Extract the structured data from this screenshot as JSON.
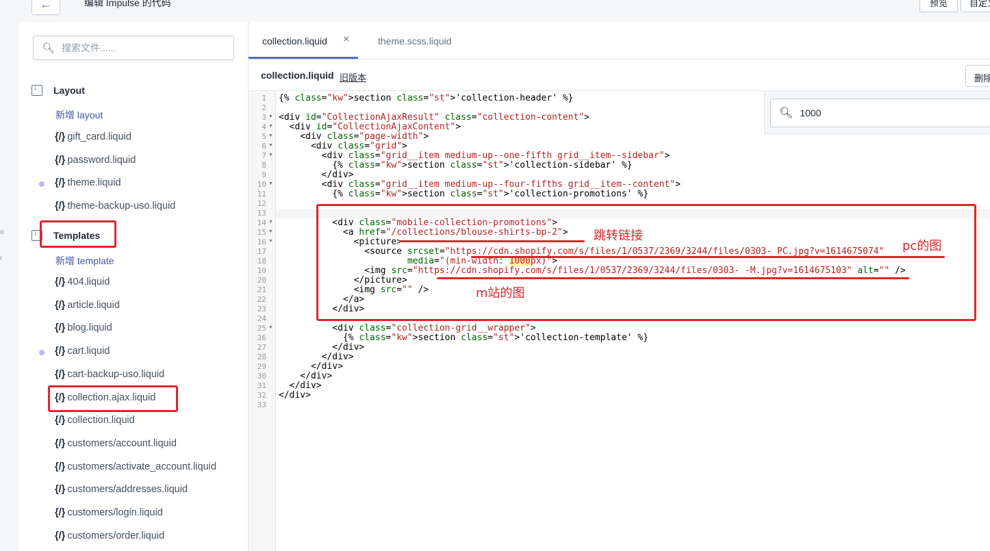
{
  "header": {
    "title": "编辑 Impulse 的代码",
    "back_icon": "arrow-left-icon",
    "preview_label": "预览",
    "customize_label": "自定义"
  },
  "left_gutter_marks": [
    "o",
    "r"
  ],
  "sidebar": {
    "search_placeholder": "搜索文件......",
    "layout": {
      "title": "Layout",
      "add_label": "新增 layout",
      "files": [
        {
          "name": "gift_card.liquid",
          "modified": false
        },
        {
          "name": "password.liquid",
          "modified": false
        },
        {
          "name": "theme.liquid",
          "modified": true
        },
        {
          "name": "theme-backup-uso.liquid",
          "modified": false
        }
      ]
    },
    "templates": {
      "title": "Templates",
      "add_label": "新增 template",
      "files": [
        {
          "name": "404.liquid",
          "modified": false
        },
        {
          "name": "article.liquid",
          "modified": false
        },
        {
          "name": "blog.liquid",
          "modified": false
        },
        {
          "name": "cart.liquid",
          "modified": true
        },
        {
          "name": "cart-backup-uso.liquid",
          "modified": false
        },
        {
          "name": "collection.ajax.liquid",
          "modified": false
        },
        {
          "name": "collection.liquid",
          "modified": false
        },
        {
          "name": "customers/account.liquid",
          "modified": false
        },
        {
          "name": "customers/activate_account.liquid",
          "modified": false
        },
        {
          "name": "customers/addresses.liquid",
          "modified": false
        },
        {
          "name": "customers/login.liquid",
          "modified": false
        },
        {
          "name": "customers/order.liquid",
          "modified": false
        }
      ]
    },
    "file_icon": "{/}"
  },
  "editor": {
    "tabs": [
      {
        "label": "collection.liquid",
        "active": true
      },
      {
        "label": "theme.scss.liquid",
        "active": false
      }
    ],
    "close_icon": "×",
    "file_name": "collection.liquid",
    "old_versions_label": "旧版本",
    "delete_label": "删除",
    "find_value": "1000",
    "line_count": 33,
    "fold_lines": [
      3,
      4,
      5,
      6,
      7,
      10,
      14,
      15,
      16,
      25
    ],
    "code_lines": [
      "{% section 'collection-header' %}",
      "",
      "<div id=\"CollectionAjaxResult\" class=\"collection-content\">",
      "  <div id=\"CollectionAjaxContent\">",
      "    <div class=\"page-width\">",
      "      <div class=\"grid\">",
      "        <div class=\"grid__item medium-up--one-fifth grid__item--sidebar\">",
      "          {% section 'collection-sidebar' %}",
      "        </div>",
      "        <div class=\"grid__item medium-up--four-fifths grid__item--content\">",
      "          {% section 'collection-promotions' %}",
      "",
      "",
      "          <div class=\"mobile-collection-promotions\">",
      "            <a href=\"/collections/blouse-shirts-bp-2\">",
      "              <picture>",
      "                <source srcset=\"https://cdn.shopify.com/s/files/1/0537/2369/3244/files/0303- PC.jpg?v=1614675074\"",
      "                        media=\"(min-width: 1000px)\">",
      "                <img src=\"https://cdn.shopify.com/s/files/1/0537/2369/3244/files/0303- -M.jpg?v=1614675103\" alt=\"\" />",
      "              </picture>",
      "              <img src=\"\" />",
      "            </a>",
      "          </div>",
      "",
      "          <div class=\"collection-grid__wrapper\">",
      "            {% section 'collection-template' %}",
      "          </div>",
      "        </div>",
      "      </div>",
      "    </div>",
      "  </div>",
      "</div>",
      ""
    ]
  },
  "annotations": {
    "link_label": "跳转链接",
    "pc_label": "pc的图",
    "m_label": "m站的图"
  }
}
